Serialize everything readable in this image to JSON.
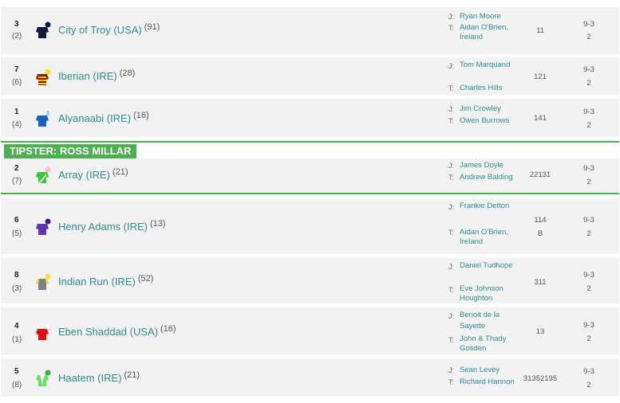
{
  "labels": {
    "jockey_prefix": "J:",
    "trainer_prefix": "T:"
  },
  "tipster": {
    "label": "TIPSTER: ROSS MILLAR"
  },
  "runners": [
    {
      "number": "3",
      "draw": "(2)",
      "name": "City of Troy (USA)",
      "rating": "(91)",
      "jockey": "Ryan Moore",
      "trainer": "Aidan O'Brien, Ireland",
      "form": "11",
      "form2": "",
      "weight": "9-3",
      "or": "2",
      "silk_colors": [
        "#0d1b3e",
        "#0d1b3e"
      ],
      "silk_icon": "jockey-silks-icon"
    },
    {
      "number": "7",
      "draw": "(6)",
      "name": "Iberian (IRE)",
      "rating": "(28)",
      "jockey": "Tom Marquand",
      "trainer": "Charles Hills",
      "form": "121",
      "form2": "",
      "weight": "9-3",
      "or": "2",
      "silk_colors": [
        "#8b1a1a",
        "#f2c200"
      ],
      "silk_icon": "jockey-silks-icon"
    },
    {
      "number": "1",
      "draw": "(4)",
      "name": "Alyanaabi (IRE)",
      "rating": "(16)",
      "jockey": "Jim Crowley",
      "trainer": "Owen Burrows",
      "form": "141",
      "form2": "",
      "weight": "9-3",
      "or": "2",
      "silk_colors": [
        "#1565c0",
        "#90caf9"
      ],
      "silk_icon": "jockey-silks-icon"
    },
    {
      "number": "2",
      "draw": "(7)",
      "name": "Array (IRE)",
      "rating": "(21)",
      "jockey": "James Doyle",
      "trainer": "Andrew Balding",
      "form": "22131",
      "form2": "",
      "weight": "9-3",
      "or": "2",
      "silk_colors": [
        "#33cc33",
        "#f8bbd0"
      ],
      "silk_icon": "jockey-silks-icon"
    },
    {
      "number": "6",
      "draw": "(5)",
      "name": "Henry Adams (IRE)",
      "rating": "(13)",
      "jockey": "Frankie Dettori",
      "trainer": "Aidan O'Brien, Ireland",
      "form": "114",
      "form2": "B",
      "weight": "9-3",
      "or": "2",
      "silk_colors": [
        "#5e35b1",
        "#4a148c"
      ],
      "silk_icon": "jockey-silks-icon"
    },
    {
      "number": "8",
      "draw": "(3)",
      "name": "Indian Run (IRE)",
      "rating": "(52)",
      "jockey": "Daniel Tudhope",
      "trainer": "Eve Johnson Houghton",
      "form": "311",
      "form2": "",
      "weight": "9-3",
      "or": "2",
      "silk_colors": [
        "#808080",
        "#f5e52a"
      ],
      "silk_icon": "jockey-silks-icon"
    },
    {
      "number": "4",
      "draw": "(1)",
      "name": "Eben Shaddad (USA)",
      "rating": "(16)",
      "jockey": "Benoit de la Sayette",
      "trainer": "John & Thady Gosden",
      "form": "13",
      "form2": "",
      "weight": "9-3",
      "or": "2",
      "silk_colors": [
        "#e01010",
        "#ffffff"
      ],
      "silk_icon": "jockey-silks-icon"
    },
    {
      "number": "5",
      "draw": "(8)",
      "name": "Haatem (IRE)",
      "rating": "(21)",
      "jockey": "Sean Levey",
      "trainer": "Richard Hannon",
      "form": "31352195",
      "form2": "",
      "weight": "9-3",
      "or": "2",
      "silk_colors": [
        "#ffffff",
        "#2eb82e"
      ],
      "silk_icon": "jockey-silks-icon"
    }
  ]
}
